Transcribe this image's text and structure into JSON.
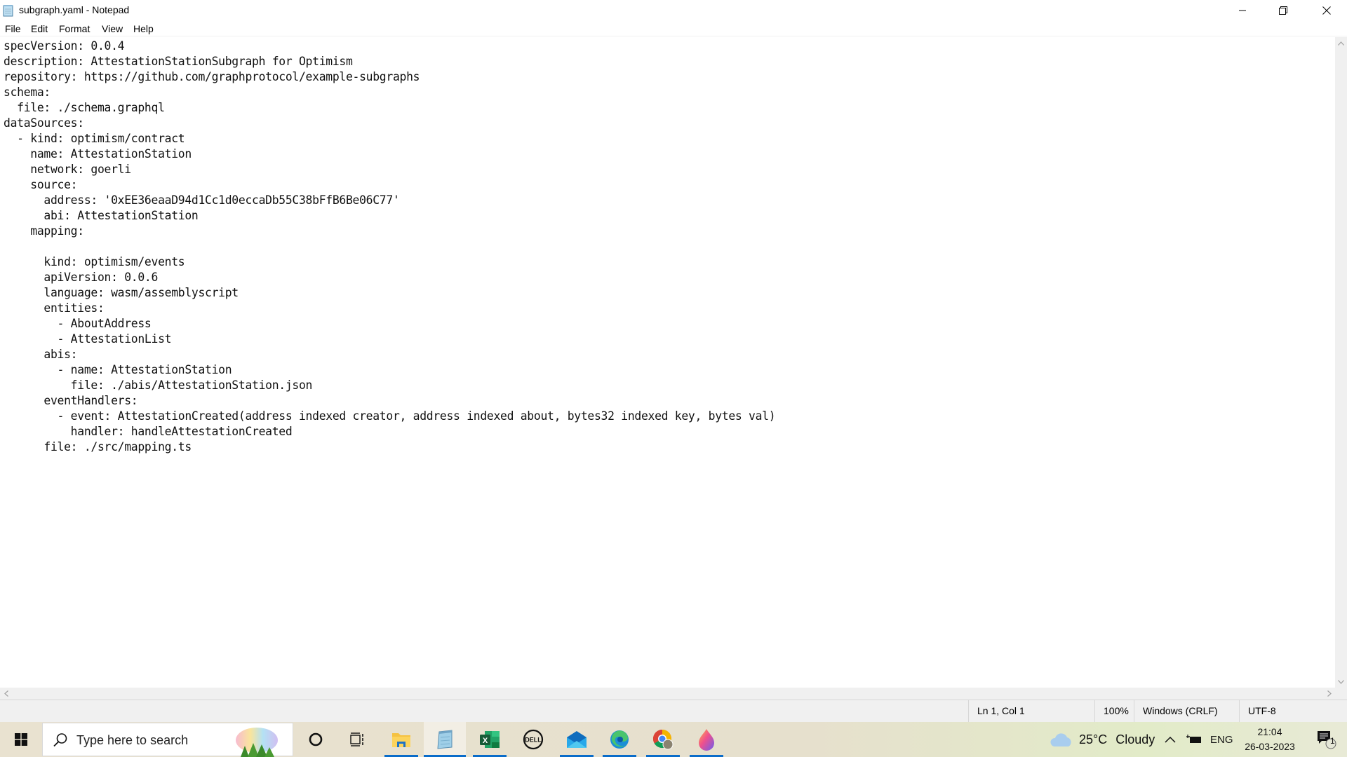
{
  "window": {
    "title": "subgraph.yaml - Notepad",
    "controls": {
      "minimize": "minimize",
      "maximize": "restore",
      "close": "close"
    }
  },
  "menu": {
    "items": [
      "File",
      "Edit",
      "Format",
      "View",
      "Help"
    ]
  },
  "editor": {
    "lines": [
      "specVersion: 0.0.4",
      "description: AttestationStationSubgraph for Optimism",
      "repository: https://github.com/graphprotocol/example-subgraphs",
      "schema:",
      "  file: ./schema.graphql",
      "dataSources:",
      "  - kind: optimism/contract",
      "    name: AttestationStation",
      "    network: goerli",
      "    source:",
      "      address: '0xEE36eaaD94d1Cc1d0eccaDb55C38bFfB6Be06C77'",
      "      abi: AttestationStation",
      "    mapping:",
      "",
      "      kind: optimism/events",
      "      apiVersion: 0.0.6",
      "      language: wasm/assemblyscript",
      "      entities:",
      "        - AboutAddress",
      "        - AttestationList",
      "      abis:",
      "        - name: AttestationStation",
      "          file: ./abis/AttestationStation.json",
      "      eventHandlers:",
      "        - event: AttestationCreated(address indexed creator, address indexed about, bytes32 indexed key, bytes val)",
      "          handler: handleAttestationCreated",
      "      file: ./src/mapping.ts"
    ]
  },
  "status": {
    "position": "Ln 1, Col 1",
    "zoom": "100%",
    "line_ending": "Windows (CRLF)",
    "encoding": "UTF-8"
  },
  "taskbar": {
    "search_placeholder": "Type here to search",
    "apps": [
      {
        "name": "cortana",
        "icon": "cortana-icon"
      },
      {
        "name": "task-view",
        "icon": "task-view-icon"
      },
      {
        "name": "file-explorer",
        "icon": "folder-icon",
        "running": true
      },
      {
        "name": "notepad",
        "icon": "notepad-icon",
        "running": true,
        "active": true
      },
      {
        "name": "excel",
        "icon": "excel-icon",
        "running": true
      },
      {
        "name": "dell",
        "icon": "dell-icon"
      },
      {
        "name": "mail",
        "icon": "mail-icon",
        "running": true
      },
      {
        "name": "edge",
        "icon": "edge-icon",
        "running": true
      },
      {
        "name": "chrome",
        "icon": "chrome-icon",
        "running": true
      },
      {
        "name": "paint",
        "icon": "paint-icon",
        "running": true
      }
    ],
    "weather": {
      "temp": "25°C",
      "condition": "Cloudy"
    },
    "language": "ENG",
    "time": "21:04",
    "date": "26-03-2023",
    "notification_count": "1"
  },
  "colors": {
    "taskbar_accent": "#0a6cc9",
    "excel_green": "#1d6f42"
  }
}
